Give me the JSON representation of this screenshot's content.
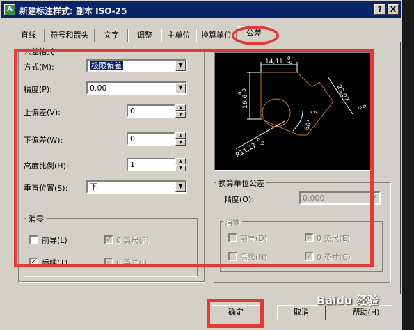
{
  "title": "新建标注样式: 副本 ISO-25",
  "title_buttons": {
    "help": "?",
    "close": "X"
  },
  "tabs": [
    {
      "label": "直线",
      "active": false
    },
    {
      "label": "符号和箭头",
      "active": false
    },
    {
      "label": "文字",
      "active": false
    },
    {
      "label": "调整",
      "active": false
    },
    {
      "label": "主单位",
      "active": false
    },
    {
      "label": "换算单位",
      "active": false
    },
    {
      "label": "公差",
      "active": true
    }
  ],
  "tolerance_format": {
    "group_label": "公差格式",
    "method": {
      "label": "方式(M):",
      "value": "极限偏差"
    },
    "precision": {
      "label": "精度(P):",
      "value": "0.00"
    },
    "upper": {
      "label": "上偏差(V):",
      "value": "0"
    },
    "lower": {
      "label": "下偏差(W):",
      "value": "0"
    },
    "height_scale": {
      "label": "高度比例(H):",
      "value": "1"
    },
    "vertical_position": {
      "label": "垂直位置(S):",
      "value": "下"
    },
    "zero_suppression": {
      "group_label": "消零",
      "leading": {
        "label": "前导(L)",
        "checked": false
      },
      "trailing": {
        "label": "后续(T)",
        "checked": true
      },
      "feet": {
        "label": "0 英尺(F)",
        "checked": true
      },
      "inches": {
        "label": "0 英寸(I)",
        "checked": true
      }
    }
  },
  "preview": {
    "dim_top": "14,11",
    "dim_left": "16,6",
    "dim_right": "23,07",
    "dim_angle": "60°",
    "dim_radius": "R11,17",
    "tol_zero": "0",
    "tol_zero_minus": "-0"
  },
  "alt_unit_tolerance": {
    "group_label": "换算单位公差",
    "precision": {
      "label": "精度(O):",
      "value": "0.000"
    },
    "zero_suppression": {
      "group_label": "消零",
      "leading": {
        "label": "前导(D)",
        "checked": false
      },
      "trailing": {
        "label": "后续(N)",
        "checked": false
      },
      "feet": {
        "label": "0 英尺(E)",
        "checked": true
      },
      "inches": {
        "label": "0 英寸(C)",
        "checked": true
      }
    }
  },
  "buttons": {
    "ok": "确定",
    "cancel": "取消",
    "help": "帮助(H)"
  },
  "watermark": "Baidu 经验",
  "colors": {
    "titlebar": "#0a246a",
    "face": "#d4d0c8",
    "highlight": "#e53935"
  }
}
